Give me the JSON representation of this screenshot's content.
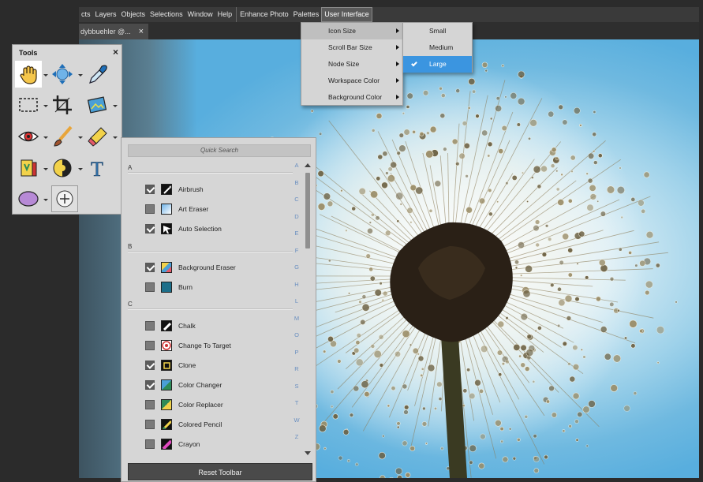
{
  "menubar": {
    "items": [
      "cts",
      "Layers",
      "Objects",
      "Selections",
      "Window",
      "Help",
      "Enhance Photo",
      "Palettes",
      "User Interface"
    ]
  },
  "document": {
    "tab_title": "dybbuehler @...",
    "close_glyph": "×"
  },
  "tools_panel": {
    "title": "Tools",
    "close_glyph": "×",
    "tools": [
      "pan-tool-icon",
      "move-tool-icon",
      "eyedropper-icon",
      "rectangle-select-icon",
      "crop-icon",
      "image-adjust-icon",
      "red-eye-icon",
      "paintbrush-icon",
      "eraser-icon",
      "fill-bucket-icon",
      "dodge-tool-icon",
      "text-tool-icon",
      "ellipse-shape-icon",
      "add-tool-icon"
    ]
  },
  "palette": {
    "search_placeholder": "Quick Search",
    "groups": [
      {
        "letter": "A",
        "items": [
          {
            "label": "Airbrush",
            "checked": true
          },
          {
            "label": "Art Eraser",
            "checked": false
          },
          {
            "label": "Auto Selection",
            "checked": true
          }
        ]
      },
      {
        "letter": "B",
        "items": [
          {
            "label": "Background Eraser",
            "checked": true
          },
          {
            "label": "Burn",
            "checked": false
          }
        ]
      },
      {
        "letter": "C",
        "items": [
          {
            "label": "Chalk",
            "checked": false
          },
          {
            "label": "Change To Target",
            "checked": false
          },
          {
            "label": "Clone",
            "checked": true
          },
          {
            "label": "Color Changer",
            "checked": true
          },
          {
            "label": "Color Replacer",
            "checked": false
          },
          {
            "label": "Colored Pencil",
            "checked": false
          },
          {
            "label": "Crayon",
            "checked": false
          }
        ]
      }
    ],
    "alphabet": [
      "A",
      "B",
      "C",
      "D",
      "E",
      "F",
      "G",
      "H",
      "L",
      "M",
      "O",
      "P",
      "R",
      "S",
      "T",
      "W",
      "Z"
    ],
    "reset_label": "Reset Toolbar"
  },
  "ui_menu": {
    "items": [
      {
        "label": "Icon Size"
      },
      {
        "label": "Scroll Bar Size"
      },
      {
        "label": "Node Size"
      },
      {
        "label": "Workspace Color"
      },
      {
        "label": "Background Color"
      }
    ]
  },
  "icon_size_menu": {
    "items": [
      {
        "label": "Small"
      },
      {
        "label": "Medium"
      },
      {
        "label": "Large",
        "selected": true
      }
    ]
  },
  "colors": {
    "accent": "#3b95e0",
    "menubar": "#3a3a3a",
    "panel": "#d6d6d6"
  }
}
